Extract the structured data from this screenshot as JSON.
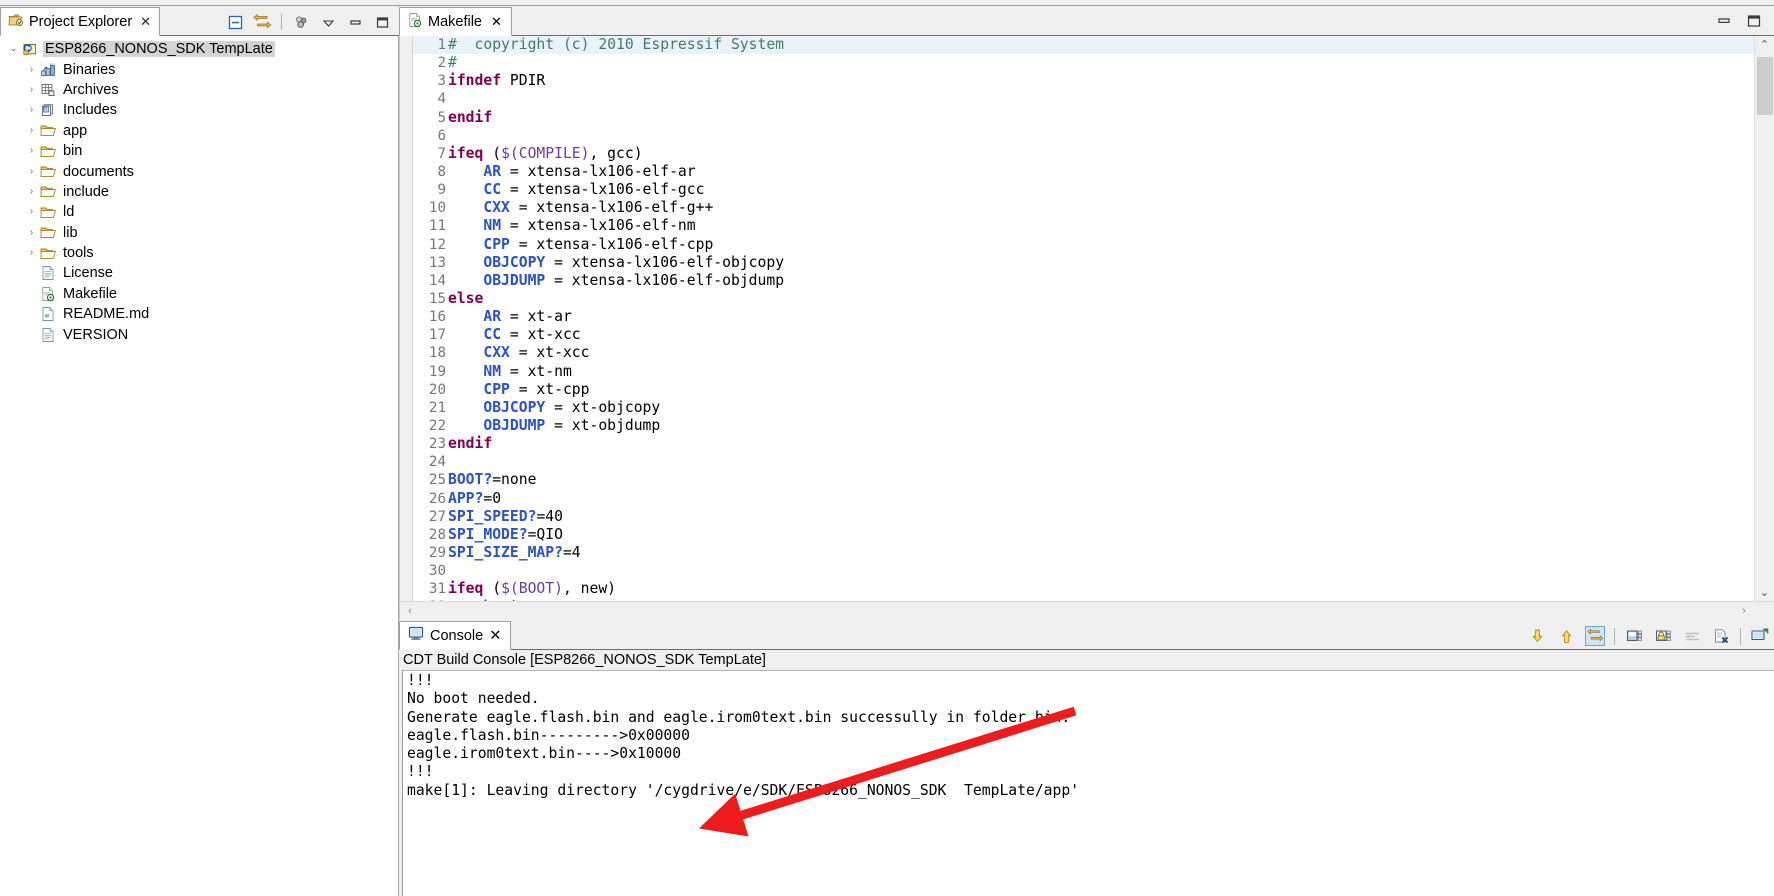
{
  "window": {
    "minimize_glyph": "▭",
    "maximize_glyph": "❐"
  },
  "project_explorer": {
    "tab_label": "Project Explorer",
    "tab_close": "✕",
    "toolbar": [
      {
        "name": "collapse-all-icon",
        "tooltip": "Collapse All"
      },
      {
        "name": "link-with-editor-icon",
        "tooltip": "Link with Editor"
      },
      {
        "name": "view-menu-filter-icon",
        "tooltip": "Filters"
      },
      {
        "name": "view-menu-icon",
        "tooltip": "View Menu"
      },
      {
        "name": "minimize-icon",
        "tooltip": "Minimize"
      },
      {
        "name": "maximize-icon",
        "tooltip": "Maximize"
      }
    ],
    "tree": [
      {
        "label": "ESP8266_NONOS_SDK  TempLate",
        "icon": "c-project-icon",
        "indent": 0,
        "twisty": "v",
        "selected": true
      },
      {
        "label": "Binaries",
        "icon": "binaries-icon",
        "indent": 1,
        "twisty": ">",
        "selected": false
      },
      {
        "label": "Archives",
        "icon": "archives-icon",
        "indent": 1,
        "twisty": ">",
        "selected": false
      },
      {
        "label": "Includes",
        "icon": "includes-icon",
        "indent": 1,
        "twisty": ">",
        "selected": false
      },
      {
        "label": "app",
        "icon": "folder-icon",
        "indent": 1,
        "twisty": ">",
        "selected": false
      },
      {
        "label": "bin",
        "icon": "folder-icon",
        "indent": 1,
        "twisty": ">",
        "selected": false
      },
      {
        "label": "documents",
        "icon": "folder-icon",
        "indent": 1,
        "twisty": ">",
        "selected": false
      },
      {
        "label": "include",
        "icon": "folder-icon",
        "indent": 1,
        "twisty": ">",
        "selected": false
      },
      {
        "label": "ld",
        "icon": "folder-icon",
        "indent": 1,
        "twisty": ">",
        "selected": false
      },
      {
        "label": "lib",
        "icon": "folder-icon",
        "indent": 1,
        "twisty": ">",
        "selected": false
      },
      {
        "label": "tools",
        "icon": "folder-icon",
        "indent": 1,
        "twisty": ">",
        "selected": false
      },
      {
        "label": "License",
        "icon": "text-file-icon",
        "indent": 1,
        "twisty": "",
        "selected": false
      },
      {
        "label": "Makefile",
        "icon": "makefile-icon",
        "indent": 1,
        "twisty": "",
        "selected": false
      },
      {
        "label": "README.md",
        "icon": "md-file-icon",
        "indent": 1,
        "twisty": "",
        "selected": false
      },
      {
        "label": "VERSION",
        "icon": "text-file-icon",
        "indent": 1,
        "twisty": "",
        "selected": false
      }
    ]
  },
  "editor": {
    "tab_label": "Makefile",
    "tab_close": "✕",
    "tab_icon": "makefile-icon",
    "lines": [
      {
        "n": "1",
        "current": true,
        "tokens": [
          {
            "t": "#  copyright (c) 2010 Espressif System",
            "c": "cmt"
          }
        ]
      },
      {
        "n": "2",
        "current": false,
        "tokens": [
          {
            "t": "#",
            "c": "cmt"
          }
        ]
      },
      {
        "n": "3",
        "current": false,
        "tokens": [
          {
            "t": "ifndef",
            "c": "kw"
          },
          {
            "t": " PDIR",
            "c": "op"
          }
        ]
      },
      {
        "n": "4",
        "current": false,
        "tokens": [
          {
            "t": "",
            "c": "op"
          }
        ]
      },
      {
        "n": "5",
        "current": false,
        "tokens": [
          {
            "t": "endif",
            "c": "kw"
          }
        ]
      },
      {
        "n": "6",
        "current": false,
        "tokens": [
          {
            "t": "",
            "c": "op"
          }
        ]
      },
      {
        "n": "7",
        "current": false,
        "tokens": [
          {
            "t": "ifeq",
            "c": "kw"
          },
          {
            "t": " (",
            "c": "op"
          },
          {
            "t": "$(COMPILE)",
            "c": "fn"
          },
          {
            "t": ", gcc)",
            "c": "op"
          }
        ]
      },
      {
        "n": "8",
        "current": false,
        "tokens": [
          {
            "t": "    ",
            "c": "op"
          },
          {
            "t": "AR",
            "c": "var"
          },
          {
            "t": " = xtensa-lx106-elf-ar",
            "c": "op"
          }
        ]
      },
      {
        "n": "9",
        "current": false,
        "tokens": [
          {
            "t": "    ",
            "c": "op"
          },
          {
            "t": "CC",
            "c": "var"
          },
          {
            "t": " = xtensa-lx106-elf-gcc",
            "c": "op"
          }
        ]
      },
      {
        "n": "10",
        "current": false,
        "tokens": [
          {
            "t": "    ",
            "c": "op"
          },
          {
            "t": "CXX",
            "c": "var"
          },
          {
            "t": " = xtensa-lx106-elf-g++",
            "c": "op"
          }
        ]
      },
      {
        "n": "11",
        "current": false,
        "tokens": [
          {
            "t": "    ",
            "c": "op"
          },
          {
            "t": "NM",
            "c": "var"
          },
          {
            "t": " = xtensa-lx106-elf-nm",
            "c": "op"
          }
        ]
      },
      {
        "n": "12",
        "current": false,
        "tokens": [
          {
            "t": "    ",
            "c": "op"
          },
          {
            "t": "CPP",
            "c": "var"
          },
          {
            "t": " = xtensa-lx106-elf-cpp",
            "c": "op"
          }
        ]
      },
      {
        "n": "13",
        "current": false,
        "tokens": [
          {
            "t": "    ",
            "c": "op"
          },
          {
            "t": "OBJCOPY",
            "c": "var"
          },
          {
            "t": " = xtensa-lx106-elf-objcopy",
            "c": "op"
          }
        ]
      },
      {
        "n": "14",
        "current": false,
        "tokens": [
          {
            "t": "    ",
            "c": "op"
          },
          {
            "t": "OBJDUMP",
            "c": "var"
          },
          {
            "t": " = xtensa-lx106-elf-objdump",
            "c": "op"
          }
        ]
      },
      {
        "n": "15",
        "current": false,
        "tokens": [
          {
            "t": "else",
            "c": "kw"
          }
        ]
      },
      {
        "n": "16",
        "current": false,
        "tokens": [
          {
            "t": "    ",
            "c": "op"
          },
          {
            "t": "AR",
            "c": "var"
          },
          {
            "t": " = xt-ar",
            "c": "op"
          }
        ]
      },
      {
        "n": "17",
        "current": false,
        "tokens": [
          {
            "t": "    ",
            "c": "op"
          },
          {
            "t": "CC",
            "c": "var"
          },
          {
            "t": " = xt-xcc",
            "c": "op"
          }
        ]
      },
      {
        "n": "18",
        "current": false,
        "tokens": [
          {
            "t": "    ",
            "c": "op"
          },
          {
            "t": "CXX",
            "c": "var"
          },
          {
            "t": " = xt-xcc",
            "c": "op"
          }
        ]
      },
      {
        "n": "19",
        "current": false,
        "tokens": [
          {
            "t": "    ",
            "c": "op"
          },
          {
            "t": "NM",
            "c": "var"
          },
          {
            "t": " = xt-nm",
            "c": "op"
          }
        ]
      },
      {
        "n": "20",
        "current": false,
        "tokens": [
          {
            "t": "    ",
            "c": "op"
          },
          {
            "t": "CPP",
            "c": "var"
          },
          {
            "t": " = xt-cpp",
            "c": "op"
          }
        ]
      },
      {
        "n": "21",
        "current": false,
        "tokens": [
          {
            "t": "    ",
            "c": "op"
          },
          {
            "t": "OBJCOPY",
            "c": "var"
          },
          {
            "t": " = xt-objcopy",
            "c": "op"
          }
        ]
      },
      {
        "n": "22",
        "current": false,
        "tokens": [
          {
            "t": "    ",
            "c": "op"
          },
          {
            "t": "OBJDUMP",
            "c": "var"
          },
          {
            "t": " = xt-objdump",
            "c": "op"
          }
        ]
      },
      {
        "n": "23",
        "current": false,
        "tokens": [
          {
            "t": "endif",
            "c": "kw"
          }
        ]
      },
      {
        "n": "24",
        "current": false,
        "tokens": [
          {
            "t": "",
            "c": "op"
          }
        ]
      },
      {
        "n": "25",
        "current": false,
        "tokens": [
          {
            "t": "BOOT?",
            "c": "var"
          },
          {
            "t": "=none",
            "c": "op"
          }
        ]
      },
      {
        "n": "26",
        "current": false,
        "tokens": [
          {
            "t": "APP?",
            "c": "var"
          },
          {
            "t": "=0",
            "c": "op"
          }
        ]
      },
      {
        "n": "27",
        "current": false,
        "tokens": [
          {
            "t": "SPI_SPEED?",
            "c": "var"
          },
          {
            "t": "=40",
            "c": "op"
          }
        ]
      },
      {
        "n": "28",
        "current": false,
        "tokens": [
          {
            "t": "SPI_MODE?",
            "c": "var"
          },
          {
            "t": "=QIO",
            "c": "op"
          }
        ]
      },
      {
        "n": "29",
        "current": false,
        "tokens": [
          {
            "t": "SPI_SIZE_MAP?",
            "c": "var"
          },
          {
            "t": "=4",
            "c": "op"
          }
        ]
      },
      {
        "n": "30",
        "current": false,
        "tokens": [
          {
            "t": "",
            "c": "op"
          }
        ]
      },
      {
        "n": "31",
        "current": false,
        "tokens": [
          {
            "t": "ifeq",
            "c": "kw"
          },
          {
            "t": " (",
            "c": "op"
          },
          {
            "t": "$(BOOT)",
            "c": "fn"
          },
          {
            "t": ", new)",
            "c": "op"
          }
        ]
      },
      {
        "n": "32",
        "current": false,
        "tokens": [
          {
            "t": "    ",
            "c": "op"
          },
          {
            "t": "boot",
            "c": "var"
          },
          {
            "t": " = new",
            "c": "op"
          }
        ]
      }
    ]
  },
  "console": {
    "tab_label": "Console",
    "tab_close": "✕",
    "tab_icon": "console-icon",
    "title": "CDT Build Console [ESP8266_NONOS_SDK  TempLate]",
    "toolbar": [
      {
        "name": "scroll-lock-down-icon",
        "tooltip": "Scroll Lock",
        "active": false
      },
      {
        "name": "scroll-up-icon",
        "tooltip": "Scroll Up",
        "active": false
      },
      {
        "name": "pin-console-icon",
        "tooltip": "Pin Console",
        "active": true
      },
      {
        "name": "display-selected-console-icon",
        "tooltip": "Display Selected Console",
        "active": false
      },
      {
        "name": "lock-console-icon",
        "tooltip": "Lock Console",
        "active": false
      },
      {
        "name": "word-wrap-icon",
        "tooltip": "Word Wrap",
        "active": false
      },
      {
        "name": "clear-console-icon",
        "tooltip": "Clear Console",
        "active": false
      },
      {
        "name": "open-console-icon",
        "tooltip": "Open Console",
        "active": false
      }
    ],
    "output": [
      "!!!",
      "No boot needed.",
      "Generate eagle.flash.bin and eagle.irom0text.bin successully in folder bin.",
      "eagle.flash.bin--------->0x00000",
      "eagle.irom0text.bin---->0x10000",
      "!!!",
      "make[1]: Leaving directory '/cygdrive/e/SDK/ESP8266_NONOS_SDK  TempLate/app'"
    ]
  },
  "annotation": {
    "arrow_color": "#ee1c1c",
    "name": "red-pointer-arrow"
  }
}
